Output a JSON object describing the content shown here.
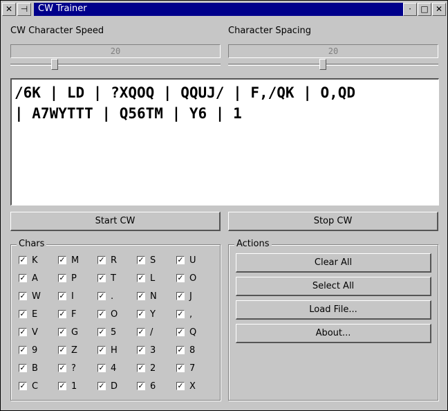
{
  "window": {
    "title": "CW Trainer",
    "icons": {
      "close": "close-icon",
      "pin": "pin-icon",
      "minimize": "minimize-icon",
      "maximize": "maximize-icon",
      "exit": "exit-icon"
    }
  },
  "speed": {
    "label": "CW Character Speed",
    "value": "20",
    "level": 0.2
  },
  "spacing": {
    "label": "Character Spacing",
    "value": "20",
    "level": 0.45
  },
  "output_text": "/6K | LD | ?XQOQ | QQUJ/ | F,/QK | O,QD\n| A7WYTTT | Q56TM | Y6 | 1",
  "buttons": {
    "start": "Start CW",
    "stop": "Stop CW"
  },
  "chars": {
    "title": "Chars",
    "rows": [
      [
        "K",
        "M",
        "R",
        "S",
        "U"
      ],
      [
        "A",
        "P",
        "T",
        "L",
        "O"
      ],
      [
        "W",
        "I",
        ".",
        "N",
        "J"
      ],
      [
        "E",
        "F",
        "O",
        "Y",
        ","
      ],
      [
        "V",
        "G",
        "5",
        "/",
        "Q"
      ],
      [
        "9",
        "Z",
        "H",
        "3",
        "8"
      ],
      [
        "B",
        "?",
        "4",
        "2",
        "7"
      ],
      [
        "C",
        "1",
        "D",
        "6",
        "X"
      ]
    ],
    "checked_mark": "✓"
  },
  "actions": {
    "title": "Actions",
    "items": [
      "Clear All",
      "Select All",
      "Load File...",
      "About..."
    ]
  }
}
